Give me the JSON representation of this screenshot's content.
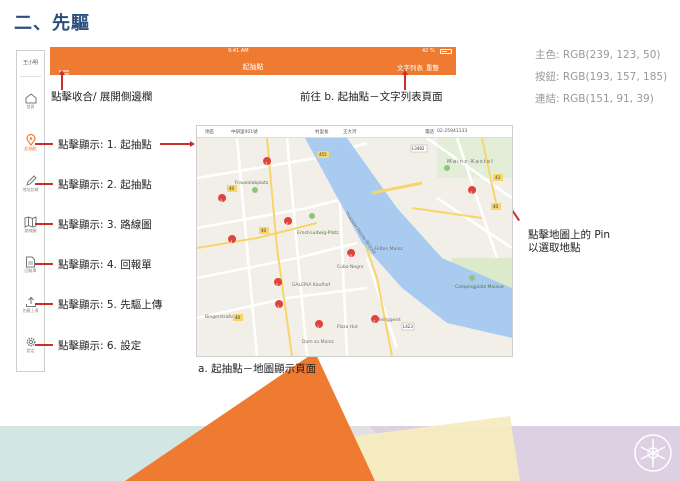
{
  "page": {
    "title": "二、先驅",
    "colors": {
      "primary": "#EF7B32",
      "button": "#C19DB9",
      "link": "#975B27",
      "annotation_line": "#C9302C",
      "title": "#2D4D7E"
    }
  },
  "color_info": {
    "primary": "主色: RGB(239, 123, 50)",
    "button": "按鈕: RGB(193, 157, 185)",
    "link": "連結: RGB(151, 91, 39)"
  },
  "sidebar": {
    "user": "王小明",
    "items": [
      {
        "label": "首頁",
        "icon": "home-icon"
      },
      {
        "label": "起抽點",
        "icon": "location-pin-icon",
        "active": true
      },
      {
        "label": "地址訪確",
        "icon": "pencil-icon"
      },
      {
        "label": "路線圖",
        "icon": "map-icon"
      },
      {
        "label": "回報單",
        "icon": "document-icon"
      },
      {
        "label": "先驅上傳",
        "icon": "upload-icon"
      },
      {
        "label": "設定",
        "icon": "gear-icon"
      }
    ]
  },
  "topbar": {
    "time": "9:41 AM",
    "battery": "42 %",
    "title": "起抽點",
    "list_button": "文字列表",
    "reset_button": "重整"
  },
  "annotations": {
    "menu_toggle": "點擊收合/ 展開側邊欄",
    "goto_list": "前往 b. 起抽點－文字列表頁面",
    "show_1": "點擊顯示: 1. 起抽點",
    "show_2": "點擊顯示: 2. 起抽點",
    "show_3": "點擊顯示: 3. 路線圖",
    "show_4": "點擊顯示: 4. 回報單",
    "show_5": "點擊顯示: 5. 先驅上傳",
    "show_6": "點擊顯示: 6. 設定",
    "map_caption": "a. 起抽點－地圖顯示頁面",
    "pin_hint_1": "點擊地圖上的 Pin",
    "pin_hint_2": "以選取地點"
  },
  "map_header": {
    "area_label": "地區",
    "area_value": "中研里001號",
    "owner_label": "村里長",
    "owner_value": "王大河",
    "phone_label": "電話",
    "phone_value": "02-25941133"
  },
  "map": {
    "place_labels": [
      "Frauenlobplatz",
      "Kaiser Friedrich Ring",
      "Ernst-Ludwig-Platz",
      "Hilton Mainz",
      "Markt",
      "Cubo Negro",
      "Kaufhof",
      "GALERIA Kaufhof",
      "Pizza Hut",
      "Heiliggeist",
      "Mainz-Kastel",
      "Campingplatz Maiaue",
      "Bingerstraße",
      "Dom zu Mainz",
      "Theodor-Heuss-Brücke",
      "Rheinstraße"
    ],
    "road_numbers": [
      "455",
      "40",
      "40",
      "L3482",
      "L423",
      "40",
      "43",
      "40"
    ],
    "pins": [
      "1",
      "2",
      "3",
      "4",
      "5",
      "6",
      "7",
      "8",
      "9",
      "10"
    ]
  }
}
